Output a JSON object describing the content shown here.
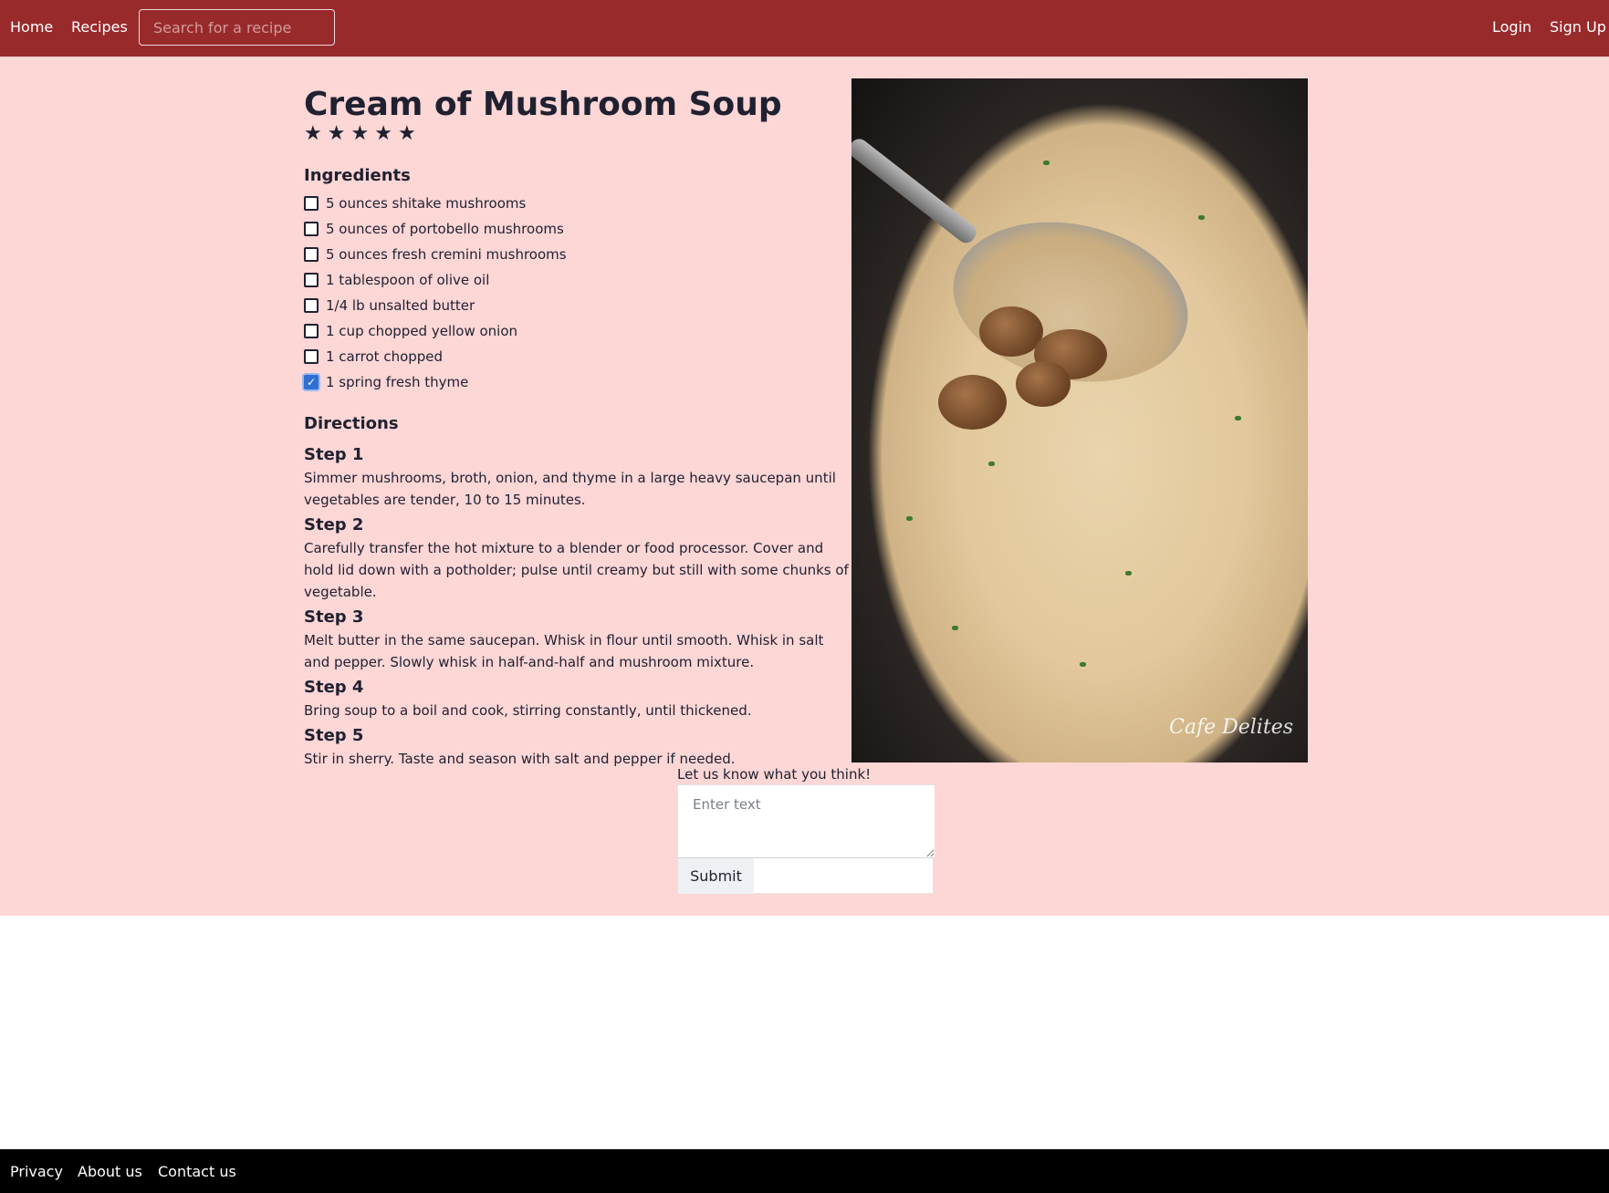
{
  "nav": {
    "home": "Home",
    "recipes": "Recipes",
    "search_placeholder": "Search for a recipe",
    "login": "Login",
    "signup": "Sign Up"
  },
  "recipe": {
    "title": "Cream of Mushroom Soup",
    "rating": {
      "stars": 5,
      "max": 5
    },
    "ingredients_heading": "Ingredients",
    "ingredients": [
      {
        "text": "5 ounces shitake mushrooms",
        "checked": false
      },
      {
        "text": "5 ounces of portobello mushrooms",
        "checked": false
      },
      {
        "text": "5 ounces fresh cremini mushrooms",
        "checked": false
      },
      {
        "text": "1 tablespoon of olive oil",
        "checked": false
      },
      {
        "text": "1/4 lb unsalted butter",
        "checked": false
      },
      {
        "text": "1 cup chopped yellow onion",
        "checked": false
      },
      {
        "text": "1 carrot chopped",
        "checked": false
      },
      {
        "text": "1 spring fresh thyme",
        "checked": true
      }
    ],
    "directions_heading": "Directions",
    "steps": [
      {
        "title": "Step 1",
        "text": "Simmer mushrooms, broth, onion, and thyme in a large heavy saucepan until vegetables are tender, 10 to 15 minutes."
      },
      {
        "title": "Step 2",
        "text": "Carefully transfer the hot mixture to a blender or food processor. Cover and hold lid down with a potholder; pulse until creamy but still with some chunks of vegetable."
      },
      {
        "title": "Step 3",
        "text": "Melt butter in the same saucepan. Whisk in flour until smooth. Whisk in salt and pepper. Slowly whisk in half-and-half and mushroom mixture."
      },
      {
        "title": "Step 4",
        "text": "Bring soup to a boil and cook, stirring constantly, until thickened."
      },
      {
        "title": "Step 5",
        "text": "Stir in sherry. Taste and season with salt and pepper if needed."
      }
    ],
    "photo_watermark": "Cafe Delites"
  },
  "feedback": {
    "label": "Let us know what you think!",
    "placeholder": "Enter text",
    "submit": "Submit"
  },
  "footer": {
    "privacy": "Privacy",
    "about": "About us",
    "contact": "Contact us"
  },
  "colors": {
    "header": "#992a2c",
    "page_background": "#fdd6d6",
    "footer": "#000000"
  }
}
